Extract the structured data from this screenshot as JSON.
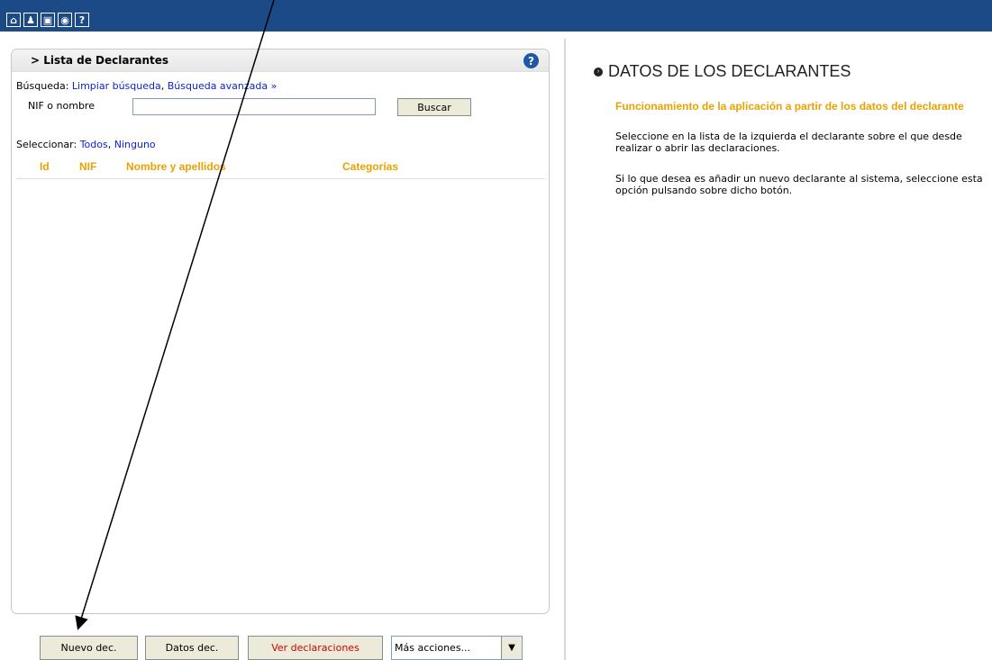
{
  "toolbar": {
    "icons": [
      {
        "name": "home-icon",
        "glyph": "⌂"
      },
      {
        "name": "user-icon",
        "glyph": "♟"
      },
      {
        "name": "shield-icon",
        "glyph": "▣"
      },
      {
        "name": "globe-icon",
        "glyph": "◉"
      },
      {
        "name": "help-icon",
        "glyph": "?"
      }
    ]
  },
  "panel": {
    "title": "> Lista de Declarantes",
    "help_glyph": "?",
    "search": {
      "label": "Búsqueda: ",
      "clear_link": "Limpiar búsqueda",
      "separator": ", ",
      "advanced_link": "Búsqueda avanzada »"
    },
    "nif_label": "NIF o nombre",
    "nif_value": "",
    "search_button": "Buscar",
    "select": {
      "label": "Seleccionar: ",
      "all_link": "Todos",
      "separator": ", ",
      "none_link": "Ninguno"
    },
    "columns": [
      "Id",
      "NIF",
      "Nombre y apellidos",
      "Categorías"
    ]
  },
  "buttons": {
    "new": "Nuevo dec.",
    "data": "Datos dec.",
    "view": "Ver declaraciones",
    "more": "Más acciones..."
  },
  "right": {
    "title": "DATOS DE LOS DECLARANTES",
    "subtitle": "Funcionamiento de la aplicación a partir de los datos del declarante",
    "p1": "Seleccione en la lista de la izquierda el declarante sobre el que desde realizar o abrir las declaraciones.",
    "p2": "Si lo que desea es añadir un nuevo declarante al sistema, seleccione esta opción pulsando sobre dicho botón."
  },
  "colors": {
    "topbar": "#1b4a86",
    "header_text": "#e8a300",
    "link": "#0b1fd6",
    "view_button_text": "#d00000"
  }
}
